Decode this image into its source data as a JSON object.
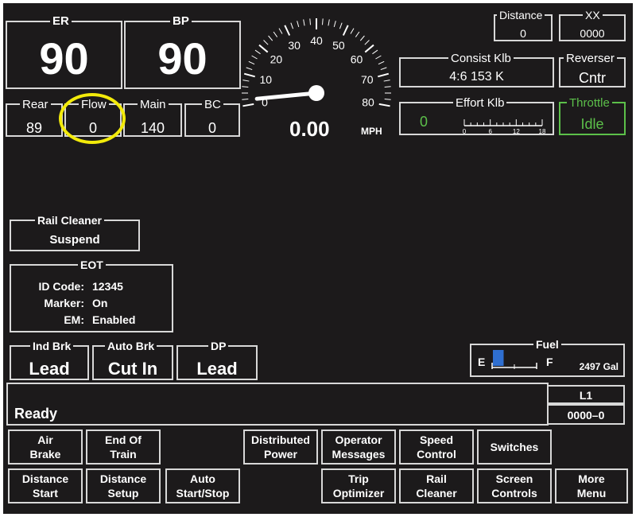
{
  "gauges": {
    "er": {
      "label": "ER",
      "value": "90"
    },
    "bp": {
      "label": "BP",
      "value": "90"
    },
    "rear": {
      "label": "Rear",
      "value": "89"
    },
    "flow": {
      "label": "Flow",
      "value": "0"
    },
    "main": {
      "label": "Main",
      "value": "140"
    },
    "bc": {
      "label": "BC",
      "value": "0"
    }
  },
  "speedometer": {
    "ticks": [
      "0",
      "10",
      "20",
      "30",
      "40",
      "50",
      "60",
      "70",
      "80"
    ],
    "speed": "0.00",
    "unit": "MPH",
    "max": 80,
    "value": 0
  },
  "distance": {
    "label": "Distance",
    "value": "0"
  },
  "xx": {
    "label": "XX",
    "value": "0000"
  },
  "consist": {
    "label": "Consist Klb",
    "value": "4:6 153 K"
  },
  "reverser": {
    "label": "Reverser",
    "value": "Cntr"
  },
  "effort": {
    "label": "Effort Klb",
    "value": "0",
    "ticks": [
      "0",
      "6",
      "12",
      "18"
    ]
  },
  "throttle": {
    "label": "Throttle",
    "value": "Idle"
  },
  "rail_cleaner": {
    "label": "Rail Cleaner",
    "value": "Suspend"
  },
  "eot": {
    "title": "EOT",
    "rows": [
      {
        "key": "ID Code:",
        "value": "12345"
      },
      {
        "key": "Marker:",
        "value": "On"
      },
      {
        "key": "EM:",
        "value": "Enabled"
      }
    ]
  },
  "modes": {
    "ind_brk": {
      "label": "Ind Brk",
      "value": "Lead"
    },
    "auto_brk": {
      "label": "Auto Brk",
      "value": "Cut In"
    },
    "dp": {
      "label": "DP",
      "value": "Lead"
    }
  },
  "fuel": {
    "label": "Fuel",
    "empty": "E",
    "full": "F",
    "amount": "2497 Gal",
    "level": 0.25
  },
  "status": {
    "message": "Ready",
    "locomotive": "L1",
    "code": "0000–0"
  },
  "menu": {
    "air_brake": [
      "Air",
      "Brake"
    ],
    "end_of_train": [
      "End Of",
      "Train"
    ],
    "distributed_power": [
      "Distributed",
      "Power"
    ],
    "operator_messages": [
      "Operator",
      "Messages"
    ],
    "speed_control": [
      "Speed",
      "Control"
    ],
    "switches": [
      "Switches"
    ],
    "distance_start": [
      "Distance",
      "Start"
    ],
    "distance_setup": [
      "Distance",
      "Setup"
    ],
    "auto_start_stop": [
      "Auto",
      "Start/Stop"
    ],
    "trip_optimizer": [
      "Trip",
      "Optimizer"
    ],
    "rail_cleaner": [
      "Rail",
      "Cleaner"
    ],
    "screen_controls": [
      "Screen",
      "Controls"
    ],
    "more_menu": [
      "More",
      "Menu"
    ]
  },
  "colors": {
    "background": "#1c1a1b",
    "throttle": "#5cc04a",
    "effort_value": "#5cc04a",
    "fuel_bar": "#2f6fd0",
    "highlight_circle": "#f2ea0a"
  }
}
